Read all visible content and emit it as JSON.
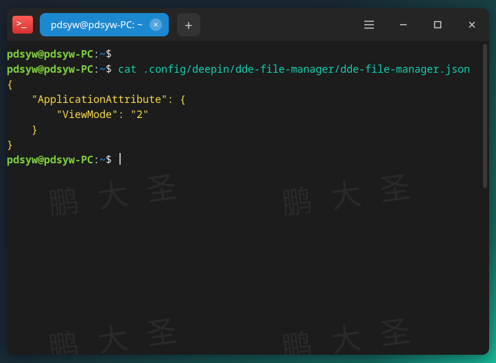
{
  "titlebar": {
    "tab_title": "pdsyw@pdsyw-PC: ~",
    "tab_close_glyph": "×",
    "new_tab_glyph": "+"
  },
  "prompt": {
    "userhost": "pdsyw@pdsyw-PC",
    "colon": ":",
    "cwd": "~",
    "symbol": "$"
  },
  "lines": {
    "cmd1": "",
    "cmd2": "cat .config/deepin/dde-file-manager/dde-file-manager.json",
    "out1": "{",
    "out2": "    \"ApplicationAttribute\": {",
    "out3": "        \"ViewMode\": \"2\"",
    "out4": "    }",
    "out5": "}"
  },
  "watermark": "鹏大圣"
}
